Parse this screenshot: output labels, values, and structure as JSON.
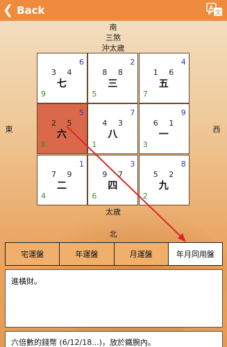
{
  "nav": {
    "back_label": "Back",
    "language_icon": "language-icon"
  },
  "directions": {
    "south": "南",
    "south_note_1": "三煞",
    "south_note_2": "沖太歲",
    "east": "東",
    "west": "西",
    "bottom_note": "太歲",
    "north": "北"
  },
  "grid": [
    {
      "tl": "3 4",
      "tr": "6",
      "center": "七",
      "bl": "9",
      "highlight": false
    },
    {
      "tl": "8 8",
      "tr": "2",
      "center": "三",
      "bl": "5",
      "highlight": false
    },
    {
      "tl": "1 6",
      "tr": "4",
      "center": "五",
      "bl": "7",
      "highlight": false
    },
    {
      "tl": "2 5",
      "tr": "5",
      "center": "六",
      "bl": "8",
      "highlight": true
    },
    {
      "tl": "4 3",
      "tr": "7",
      "center": "八",
      "bl": "1",
      "highlight": false
    },
    {
      "tl": "6 1",
      "tr": "9",
      "center": "一",
      "bl": "3",
      "highlight": false
    },
    {
      "tl": "7 9",
      "tr": "1",
      "center": "二",
      "bl": "4",
      "highlight": false
    },
    {
      "tl": "9 7",
      "tr": "3",
      "center": "四",
      "bl": "6",
      "highlight": false
    },
    {
      "tl": "5 2",
      "tr": "8",
      "center": "九",
      "bl": "2",
      "highlight": false
    }
  ],
  "tabs": [
    {
      "label": "宅運盤",
      "active": false
    },
    {
      "label": "年運盤",
      "active": false
    },
    {
      "label": "月運盤",
      "active": false
    },
    {
      "label": "年月同用盤",
      "active": true
    }
  ],
  "info": {
    "line1": "進橫財。",
    "line2": "六倍數的錢幣 (6/12/18...)，放於鐵腕內。"
  },
  "colors": {
    "topbar": "#f08a3c",
    "highlight": "#d9694a",
    "arrow": "#d9262a",
    "number_blue": "#2b3bb8",
    "number_green": "#3a8b2a"
  }
}
